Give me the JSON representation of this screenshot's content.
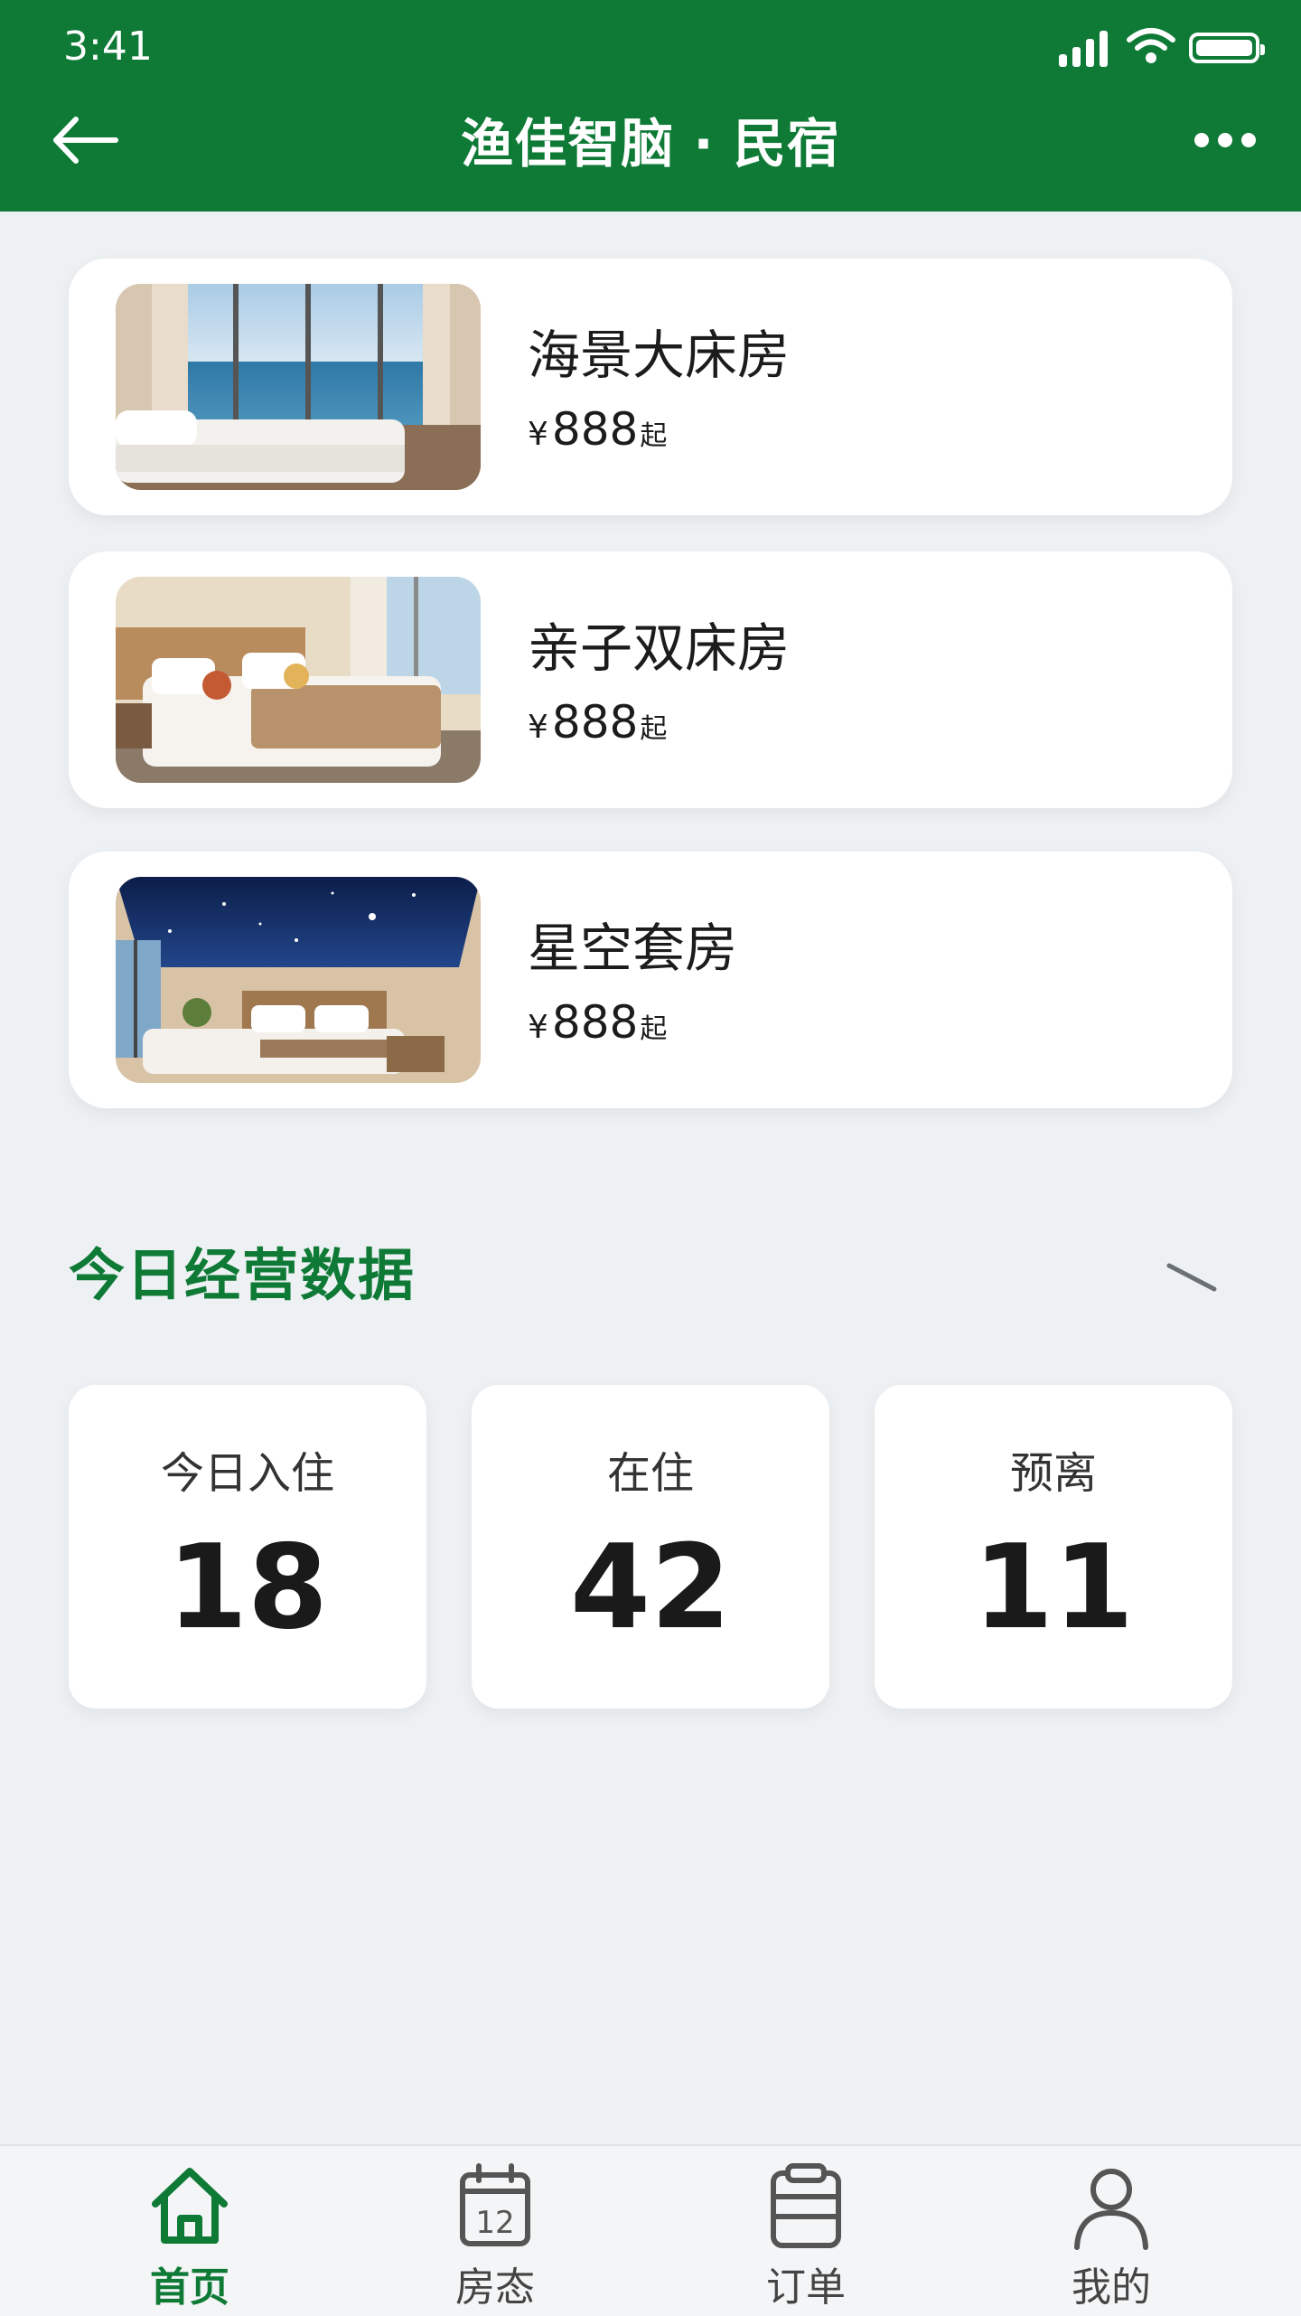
{
  "status_bar": {
    "time": "3:41"
  },
  "header": {
    "title": "渔佳智脑 · 民宿"
  },
  "rooms": [
    {
      "name": "海景大床房",
      "currency": "¥",
      "price": "888",
      "suffix": "起"
    },
    {
      "name": "亲子双床房",
      "currency": "¥",
      "price": "888",
      "suffix": "起"
    },
    {
      "name": "星空套房",
      "currency": "¥",
      "price": "888",
      "suffix": "起"
    }
  ],
  "stats_section": {
    "title": "今日经营数据",
    "cards": [
      {
        "label": "今日入住",
        "value": "18"
      },
      {
        "label": "在住",
        "value": "42"
      },
      {
        "label": "预离",
        "value": "11"
      }
    ]
  },
  "tabbar": {
    "items": [
      {
        "label": "首页",
        "icon": "home-icon",
        "active": true
      },
      {
        "label": "房态",
        "icon": "calendar-icon",
        "calendar_day": "12"
      },
      {
        "label": "订单",
        "icon": "clipboard-icon"
      },
      {
        "label": "我的",
        "icon": "user-icon"
      }
    ]
  },
  "colors": {
    "brand": "#0e7a36",
    "background": "#eef1f3"
  }
}
